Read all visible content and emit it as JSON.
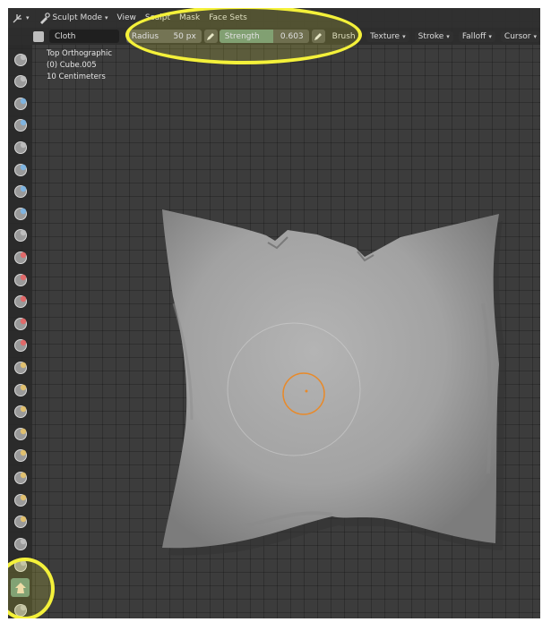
{
  "header": {
    "mode_label": "Sculpt Mode",
    "menus": [
      "View",
      "Sculpt",
      "Mask",
      "Face Sets"
    ]
  },
  "tool_settings": {
    "brush_name": "Cloth",
    "radius_label": "Radius",
    "radius_value": "50 px",
    "strength_label": "Strength",
    "strength_value": "0.603",
    "strength_fraction": 0.603,
    "menus": [
      "Brush",
      "Texture",
      "Stroke",
      "Falloff",
      "Cursor"
    ]
  },
  "viewport_info": {
    "view": "Top Orthographic",
    "object": "(0) Cube.005",
    "scale": "10 Centimeters"
  },
  "colors": {
    "highlight": "#f4f13a",
    "active_tool": "#6b9280",
    "brush_cursor": "#e88a2a",
    "cloth": "#a9a9a9"
  },
  "tools": [
    {
      "icon": "draw-brush-icon"
    },
    {
      "icon": "draw-sharp-brush-icon"
    },
    {
      "icon": "clay-brush-icon"
    },
    {
      "icon": "clay-strips-brush-icon"
    },
    {
      "icon": "clay-thumb-brush-icon"
    },
    {
      "icon": "layer-brush-icon"
    },
    {
      "icon": "inflate-brush-icon"
    },
    {
      "icon": "blob-brush-icon"
    },
    {
      "icon": "crease-brush-icon"
    },
    {
      "icon": "smooth-brush-icon"
    },
    {
      "icon": "flatten-brush-icon"
    },
    {
      "icon": "fill-brush-icon"
    },
    {
      "icon": "scrape-brush-icon"
    },
    {
      "icon": "multiplane-scrape-brush-icon"
    },
    {
      "icon": "pinch-brush-icon"
    },
    {
      "icon": "grab-brush-icon"
    },
    {
      "icon": "elastic-deform-brush-icon"
    },
    {
      "icon": "snake-hook-brush-icon"
    },
    {
      "icon": "thumb-brush-icon"
    },
    {
      "icon": "pose-brush-icon"
    },
    {
      "icon": "nudge-brush-icon"
    },
    {
      "icon": "rotate-brush-icon"
    },
    {
      "icon": "slide-relax-brush-icon"
    },
    {
      "icon": "boundary-brush-icon"
    },
    {
      "icon": "cloth-brush-icon",
      "active": true
    },
    {
      "icon": "simplify-brush-icon"
    }
  ]
}
